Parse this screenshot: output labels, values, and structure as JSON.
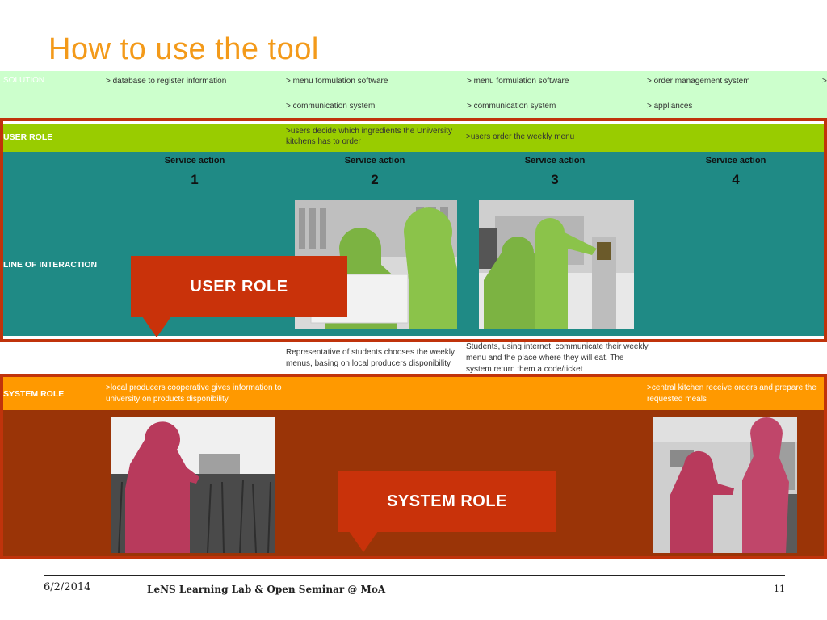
{
  "slide": {
    "title": "How to use the tool"
  },
  "solution_row": {
    "label": "SOLUTION",
    "col1": [
      "> database to register information"
    ],
    "col2": [
      "> menu formulation software",
      "> communication system"
    ],
    "col3": [
      "> menu formulation software",
      "> communication system"
    ],
    "col4": [
      "> order management system",
      "> appliances"
    ],
    "col5_partial": ">"
  },
  "user_role_row": {
    "label": "USER ROLE",
    "col2": ">users decide which ingredients the University kitchens has to order",
    "col3": ">users order the weekly menu"
  },
  "service_actions": [
    {
      "header": "Service action",
      "number": "1"
    },
    {
      "header": "Service action",
      "number": "2"
    },
    {
      "header": "Service action",
      "number": "3"
    },
    {
      "header": "Service action",
      "number": "4"
    }
  ],
  "line_of_interaction": {
    "label": "LINE OF INTERACTION"
  },
  "callouts": {
    "user_role": "USER ROLE",
    "system_role": "SYSTEM ROLE"
  },
  "captions": {
    "col2": "Representative of students chooses the weekly menus, basing on local producers disponibility",
    "col3": "Students, using internet, communicate their weekly menu and the place where they will eat. The system return them a code/ticket"
  },
  "system_role_row": {
    "label": "SYSTEM ROLE",
    "col1": ">local producers cooperative gives information to university on products disponibility",
    "col4": ">central kitchen receive orders and prepare the requested meals"
  },
  "footer": {
    "date": "6/2/2014",
    "center": "LeNS Learning Lab & Open Seminar @ MoA",
    "page": "11"
  },
  "colors": {
    "title": "#f39a1a",
    "solution_band": "#ccffcc",
    "user_role_band": "#99cc00",
    "interaction_band": "#1f8a85",
    "frame_red": "#c0330b",
    "system_band": "#ff9900",
    "system_body": "#9a3407",
    "silhouette_green": "#7cb342",
    "silhouette_magenta": "#b83a5c"
  }
}
